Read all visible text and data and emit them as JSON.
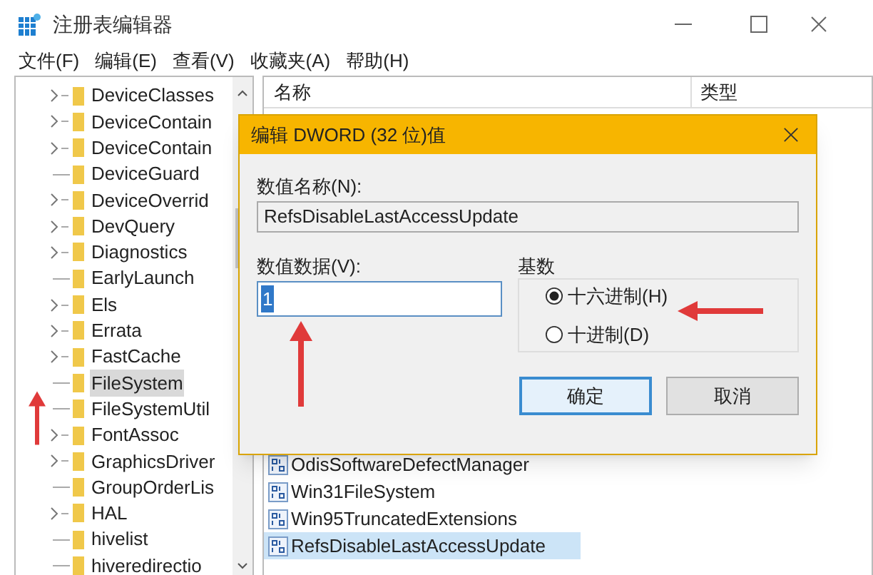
{
  "window": {
    "title": "注册表编辑器"
  },
  "menu": [
    "文件(F)",
    "编辑(E)",
    "查看(V)",
    "收藏夹(A)",
    "帮助(H)"
  ],
  "tree": [
    {
      "label": "DeviceClasses",
      "expandable": true,
      "selected": false
    },
    {
      "label": "DeviceContain",
      "expandable": true,
      "selected": false
    },
    {
      "label": "DeviceContain",
      "expandable": true,
      "selected": false
    },
    {
      "label": "DeviceGuard",
      "expandable": false,
      "selected": false
    },
    {
      "label": "DeviceOverrid",
      "expandable": true,
      "selected": false
    },
    {
      "label": "DevQuery",
      "expandable": true,
      "selected": false
    },
    {
      "label": "Diagnostics",
      "expandable": true,
      "selected": false
    },
    {
      "label": "EarlyLaunch",
      "expandable": false,
      "selected": false
    },
    {
      "label": "Els",
      "expandable": true,
      "selected": false
    },
    {
      "label": "Errata",
      "expandable": true,
      "selected": false
    },
    {
      "label": "FastCache",
      "expandable": true,
      "selected": false
    },
    {
      "label": "FileSystem",
      "expandable": false,
      "selected": true
    },
    {
      "label": "FileSystemUtil",
      "expandable": false,
      "selected": false
    },
    {
      "label": "FontAssoc",
      "expandable": true,
      "selected": false
    },
    {
      "label": "GraphicsDriver",
      "expandable": true,
      "selected": false
    },
    {
      "label": "GroupOrderLis",
      "expandable": false,
      "selected": false
    },
    {
      "label": "HAL",
      "expandable": true,
      "selected": false
    },
    {
      "label": "hivelist",
      "expandable": false,
      "selected": false
    },
    {
      "label": "hiveredirectio",
      "expandable": false,
      "selected": false
    }
  ],
  "list": {
    "columns": [
      "名称",
      "类型"
    ],
    "rows": [
      {
        "name": "OdisSoftwareDefectManager",
        "selected": false
      },
      {
        "name": "Win31FileSystem",
        "selected": false
      },
      {
        "name": "Win95TruncatedExtensions",
        "selected": false
      },
      {
        "name": "RefsDisableLastAccessUpdate",
        "selected": true
      }
    ]
  },
  "dialog": {
    "title": "编辑 DWORD (32 位)值",
    "name_label": "数值名称(N):",
    "name_value": "RefsDisableLastAccessUpdate",
    "data_label": "数值数据(V):",
    "data_value": "1",
    "base_label": "基数",
    "radios": [
      {
        "label": "十六进制(H)",
        "selected": true
      },
      {
        "label": "十进制(D)",
        "selected": false
      }
    ],
    "buttons": [
      "确定",
      "取消"
    ]
  }
}
